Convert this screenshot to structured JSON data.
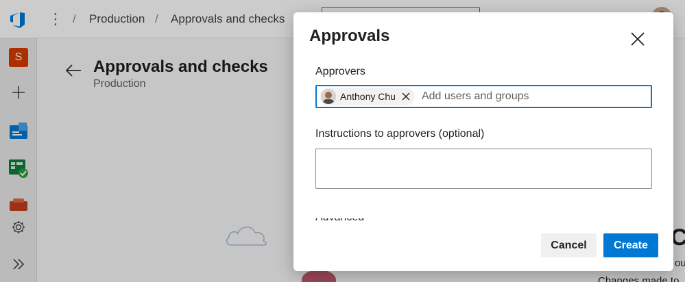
{
  "header": {
    "breadcrumbs": [
      "Production",
      "Approvals and checks"
    ],
    "separator": "/"
  },
  "leftnav": {
    "project_initial": "S",
    "icons": [
      "add-icon",
      "boards-icon",
      "test-plans-icon",
      "artifacts-icon",
      "settings-icon",
      "expand-icon"
    ]
  },
  "page": {
    "title": "Approvals and checks",
    "subtitle": "Production",
    "bg_heading_fragment": "Cr",
    "bg_text_fragment_1": "ou",
    "bg_text_fragment_2": "Changes made to"
  },
  "dialog": {
    "title": "Approvals",
    "approvers_label": "Approvers",
    "approver_chip": "Anthony Chu",
    "approvers_placeholder": "Add users and groups",
    "instructions_label": "Instructions to approvers (optional)",
    "instructions_value": "",
    "hidden_label": "Advanced",
    "cancel_label": "Cancel",
    "create_label": "Create"
  },
  "colors": {
    "accent": "#0078d4",
    "project_badge": "#d83b01"
  }
}
